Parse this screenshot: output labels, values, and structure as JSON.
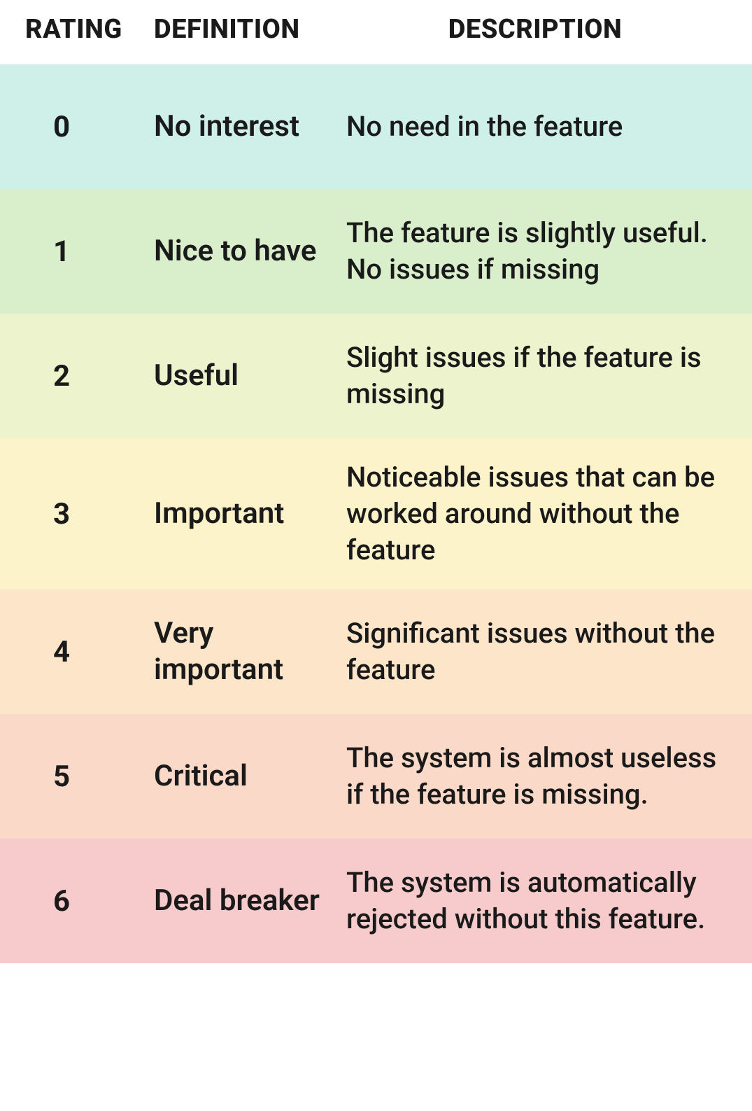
{
  "headers": {
    "rating": "RATING",
    "definition": "DEFINITION",
    "description": "DESCRIPTION"
  },
  "rows": [
    {
      "rating": "0",
      "definition": "No interest",
      "description": "No need in the feature",
      "bg": "#cff0e8"
    },
    {
      "rating": "1",
      "definition": "Nice to have",
      "description": "The feature is slightly useful. No issues if missing",
      "bg": "#d9efcb"
    },
    {
      "rating": "2",
      "definition": "Useful",
      "description": "Slight issues if the feature is missing",
      "bg": "#edf3cd"
    },
    {
      "rating": "3",
      "definition": "Important",
      "description": "Noticeable issues that can be worked around without the feature",
      "bg": "#fdf3cb"
    },
    {
      "rating": "4",
      "definition": "Very important",
      "description": "Significant issues without the feature",
      "bg": "#fde5c9"
    },
    {
      "rating": "5",
      "definition": "Critical",
      "description": "The system is almost useless if the feature is missing.",
      "bg": "#fbd9c8"
    },
    {
      "rating": "6",
      "definition": "Deal breaker",
      "description": "The system is automatically rejected without this feature.",
      "bg": "#f7cbcb"
    }
  ]
}
